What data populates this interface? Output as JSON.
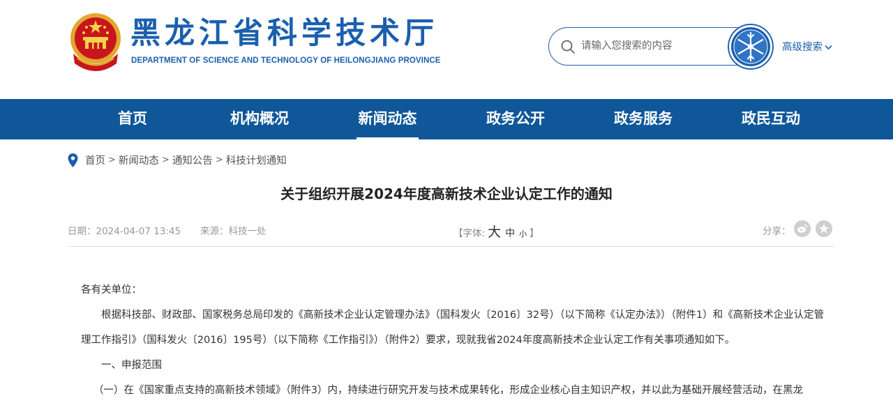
{
  "header": {
    "site_title": "黑龙江省科学技术厅",
    "site_subtitle": "DEPARTMENT OF SCIENCE AND TECHNOLOGY OF HEILONGJIANG PROVINCE",
    "search_placeholder": "请输入您搜索的内容",
    "advanced_search": "高级搜索"
  },
  "nav": {
    "items": [
      "首页",
      "机构概况",
      "新闻动态",
      "政务公开",
      "政务服务",
      "政民互动"
    ],
    "active": "新闻动态"
  },
  "breadcrumb": [
    "首页",
    "新闻动态",
    "通知公告",
    "科技计划通知"
  ],
  "breadcrumb_sep": ">",
  "article": {
    "title": "关于组织开展2024年度高新技术企业认定工作的通知",
    "date": "日期：2024-04-07 13:45",
    "source": "来源：科技一处",
    "font_ctl": {
      "open": "【字体:",
      "big": "大",
      "mid": "中",
      "small": "小",
      "close": "】"
    },
    "share_label": "分享：",
    "paragraphs": [
      "各有关单位：",
      "根据科技部、财政部、国家税务总局印发的《高新技术企业认定管理办法》（国科发火〔2016〕32号）（以下简称《认定办法》）（附件1）和《高新技术企业认定管理工作指引》（国科发火〔2016〕195号）（以下简称《工作指引》）（附件2）要求，现就我省2024年度高新技术企业认定工作有关事项通知如下。",
      "一、申报范围",
      "（一）在《国家重点支持的高新技术领域》（附件3）内，持续进行研究开发与技术成果转化，形成企业核心自主知识产权，并以此为基础开展经营活动，在黑龙"
    ]
  },
  "colors": {
    "brand_blue": "#1b5fae",
    "nav_bg": "#0f5799"
  },
  "icons": [
    "national-emblem-icon",
    "search-icon",
    "snowflake-search-icon",
    "chevron-down-icon",
    "location-pin-icon",
    "weibo-icon",
    "favorite-icon"
  ]
}
